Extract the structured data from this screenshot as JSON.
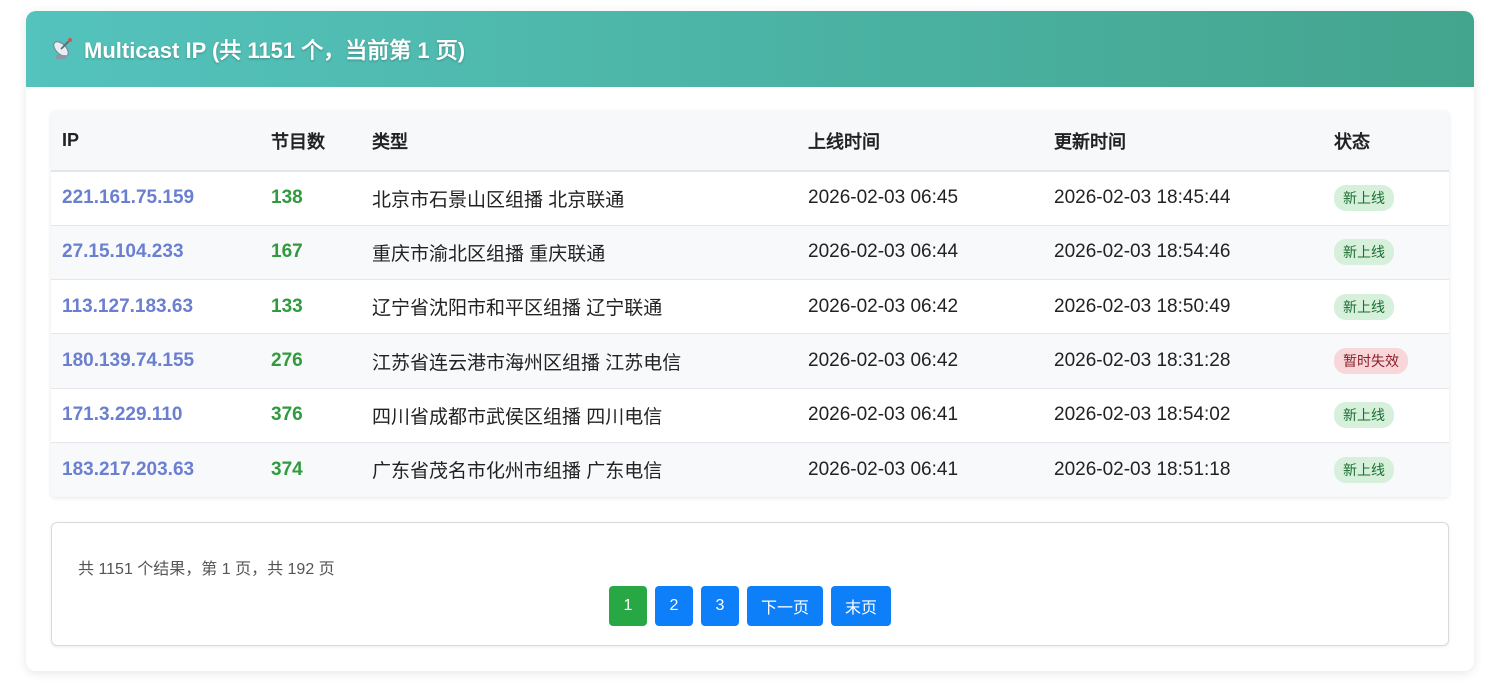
{
  "header": {
    "title": "Multicast IP (共 1151 个，当前第 1 页)",
    "icon": "satellite-antenna-icon",
    "gradient_from": "#54c3bd",
    "gradient_to": "#44a58e"
  },
  "table": {
    "columns": [
      "IP",
      "节目数",
      "类型",
      "上线时间",
      "更新时间",
      "状态"
    ],
    "rows": [
      {
        "ip": "221.161.75.159",
        "count": "138",
        "type": "北京市石景山区组播 北京联通",
        "online": "2026-02-03 06:45",
        "updated": "2026-02-03 18:45:44",
        "status": "新上线",
        "status_kind": "ok"
      },
      {
        "ip": "27.15.104.233",
        "count": "167",
        "type": "重庆市渝北区组播 重庆联通",
        "online": "2026-02-03 06:44",
        "updated": "2026-02-03 18:54:46",
        "status": "新上线",
        "status_kind": "ok"
      },
      {
        "ip": "113.127.183.63",
        "count": "133",
        "type": "辽宁省沈阳市和平区组播 辽宁联通",
        "online": "2026-02-03 06:42",
        "updated": "2026-02-03 18:50:49",
        "status": "新上线",
        "status_kind": "ok"
      },
      {
        "ip": "180.139.74.155",
        "count": "276",
        "type": "江苏省连云港市海州区组播 江苏电信",
        "online": "2026-02-03 06:42",
        "updated": "2026-02-03 18:31:28",
        "status": "暂时失效",
        "status_kind": "bad"
      },
      {
        "ip": "171.3.229.110",
        "count": "376",
        "type": "四川省成都市武侯区组播 四川电信",
        "online": "2026-02-03 06:41",
        "updated": "2026-02-03 18:54:02",
        "status": "新上线",
        "status_kind": "ok"
      },
      {
        "ip": "183.217.203.63",
        "count": "374",
        "type": "广东省茂名市化州市组播 广东电信",
        "online": "2026-02-03 06:41",
        "updated": "2026-02-03 18:51:18",
        "status": "新上线",
        "status_kind": "ok"
      }
    ]
  },
  "pagination": {
    "info": "共 1151 个结果，第 1 页，共 192 页",
    "buttons": [
      {
        "label": "1",
        "active": true
      },
      {
        "label": "2",
        "active": false
      },
      {
        "label": "3",
        "active": false
      },
      {
        "label": "下一页",
        "active": false
      },
      {
        "label": "末页",
        "active": false
      }
    ]
  },
  "colors": {
    "link": "#6b7fd1",
    "count": "#2f9a3e",
    "button": "#0d7ff9",
    "button_active": "#28a745"
  }
}
